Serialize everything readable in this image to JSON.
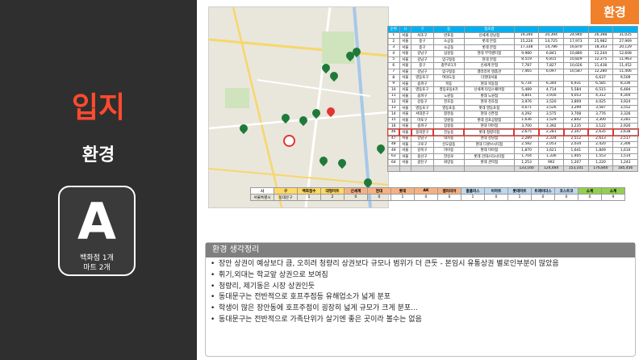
{
  "sidebar": {
    "title": "입지",
    "subtitle": "환경",
    "grade": "A",
    "lines": [
      "백화점 1개",
      "마트   2개"
    ]
  },
  "badge": "환경",
  "table": {
    "headers": [
      "순위",
      "시",
      "구",
      "동",
      "점포명",
      "",
      "",
      "",
      "",
      ""
    ],
    "rows": [
      [
        "1",
        "서울",
        "서초구",
        "반포동",
        "신세계 강남점",
        "19,340",
        "20,394",
        "24,940",
        "26,398",
        "31,025"
      ],
      [
        "2",
        "서울",
        "중구",
        "소공동",
        "롯데 본점",
        "15,226",
        "14,725",
        "17,973",
        "25,982",
        "27,969"
      ],
      [
        "3",
        "서울",
        "중구",
        "소공동",
        "롯데 본점",
        "17,338",
        "14,786",
        "16,870",
        "18,343",
        "20,129"
      ],
      [
        "4",
        "서울",
        "강남구",
        "삼성동",
        "현대 무역센터점",
        "9,980",
        "6,841",
        "10,880",
        "12,244",
        "12,608"
      ],
      [
        "5",
        "서울",
        "강남구",
        "압구정동",
        "현대 본점",
        "8,519",
        "6,815",
        "10,829",
        "12,375",
        "11,963"
      ],
      [
        "6",
        "서울",
        "중구",
        "충무로1가",
        "신세계 본점",
        "7,787",
        "7,827",
        "10,026",
        "11,438",
        "11,452"
      ],
      [
        "7",
        "서울",
        "강남구",
        "압구정동",
        "갤러리아 명품관",
        "7,465",
        "6,097",
        "10,587",
        "12,280",
        "11,406"
      ],
      [
        "8",
        "서울",
        "영등포구",
        "여의도동",
        "더현대서울",
        "",
        "",
        "",
        "6,637",
        "9,509"
      ],
      [
        "9",
        "서울",
        "송파구",
        "목동",
        "현대 목동점",
        "6,734",
        "6,344",
        "6,931",
        "6,585",
        "8,336"
      ],
      [
        "10",
        "서울",
        "영등포구",
        "영등포동4가",
        "신세계 타임스퀘어점",
        "5,489",
        "4,714",
        "5,584",
        "6,515",
        "6,484"
      ],
      [
        "11",
        "서울",
        "송파구",
        "노원동",
        "롯데 노원점",
        "4,841",
        "3,916",
        "4,053",
        "4,312",
        "4,304"
      ],
      [
        "12",
        "서울",
        "강동구",
        "천호동",
        "현대 천호점",
        "3,976",
        "3,520",
        "3,809",
        "4,025",
        "3,924"
      ],
      [
        "13",
        "서울",
        "영등포구",
        "영등포동",
        "롯데 영등포점",
        "4,671",
        "3,526",
        "3,299",
        "3,587",
        "3,552"
      ],
      [
        "14",
        "서울",
        "서대문구",
        "창천동",
        "현대 신촌점",
        "4,292",
        "3,575",
        "3,708",
        "3,776",
        "3,326"
      ],
      [
        "15",
        "서울",
        "마포구",
        "망원동",
        "롯데 김포공항점",
        "1,636",
        "1,529",
        "2,842",
        "3,300",
        "3,281"
      ],
      [
        "16",
        "서울",
        "송파구",
        "잠실동",
        "현대 미아점",
        "3,700",
        "3,392",
        "3,235",
        "3,122",
        "2,926"
      ],
      [
        "46",
        "서울",
        "동대문구",
        "전농동",
        "롯데 청량리점",
        "2,675",
        "2,281",
        "2,347",
        "2,635",
        "2,638"
      ],
      [
        "47",
        "서울",
        "강남구",
        "대치동",
        "현대 강남점",
        "2,289",
        "2,334",
        "2,512",
        "2,613",
        "2,517"
      ],
      [
        "48",
        "서울",
        "구로구",
        "신도림동",
        "현대 디큐브시티점",
        "2,582",
        "2,053",
        "2,034",
        "2,420",
        "2,306"
      ],
      [
        "49",
        "서울",
        "강북구",
        "미아동",
        "롯데 미아점",
        "1,870",
        "1,621",
        "1,641",
        "1,849",
        "1,610"
      ],
      [
        "63",
        "서울",
        "용산구",
        "한강로",
        "롯데 건대스타시티점",
        "1,704",
        "1,336",
        "1,405",
        "1,553",
        "1,514"
      ],
      [
        "64",
        "서울",
        "광진구",
        "화양동",
        "롯데 관악점",
        "1,253",
        "992",
        "1,207",
        "1,220",
        "1,243"
      ],
      [
        "",
        "",
        "",
        "",
        "",
        "133,160",
        "124,484",
        "153,101",
        "176,840",
        "185,456"
      ]
    ]
  },
  "small_table": {
    "headers": [
      "시",
      "구",
      "백화점수",
      "대형마트",
      "신세계",
      "현대",
      "롯데",
      "AK",
      "갤러리아",
      "홈플러스",
      "이마트",
      "롯데마트",
      "트레이더스",
      "코스트코",
      "소계",
      "소계"
    ],
    "values": [
      "서울특별시",
      "동대문구",
      "1",
      "2",
      "0",
      "0",
      "1",
      "0",
      "0",
      "1",
      "0",
      "1",
      "0",
      "0",
      "0",
      "9"
    ]
  },
  "notes": {
    "title": "환경 생각정리",
    "items": [
      "장안 상권이 예상보다 큼, 오히려 청량리 상권보다 규모나 범위가 더 큰듯 - 본임시 유통상권 별로인부분이 많았음",
      "휘기,외대는 학교앞 상권으로 보여짐",
      "청량리, 제기동은 시장 상권인듯",
      "동대문구는 전반적으로 호프주점등 유해업소가 넓게 분포",
      "학생이 많은 장안동에 호프주점이 굉장히 넓게 규모가 크게 분포...",
      "동대문구는 전반적으로 가족단위가 살기엔 좋은 곳이라 볼수는 없음"
    ]
  }
}
